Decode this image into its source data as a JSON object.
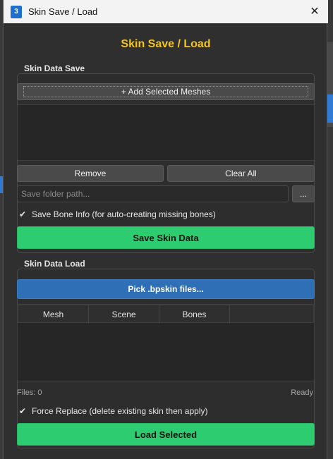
{
  "window": {
    "title": "Skin Save / Load",
    "icon_text": "3"
  },
  "heading": "Skin Save / Load",
  "save": {
    "group_label": "Skin Data Save",
    "add_button": "+ Add Selected Meshes",
    "remove_button": "Remove",
    "clear_button": "Clear All",
    "folder_placeholder": "Save folder path...",
    "browse_button": "...",
    "bone_info_label": "Save Bone Info  (for auto-creating missing bones)",
    "save_button": "Save Skin Data"
  },
  "load": {
    "group_label": "Skin Data Load",
    "pick_button": "Pick .bpskin files...",
    "columns": [
      "Mesh",
      "Scene",
      "Bones"
    ],
    "files_count": "Files: 0",
    "status": "Ready",
    "force_replace_label": "Force Replace (delete existing skin then apply)",
    "load_button": "Load Selected"
  },
  "colors": {
    "heading": "#f5c518",
    "green": "#2ecc71",
    "blue": "#2e6fb5"
  }
}
